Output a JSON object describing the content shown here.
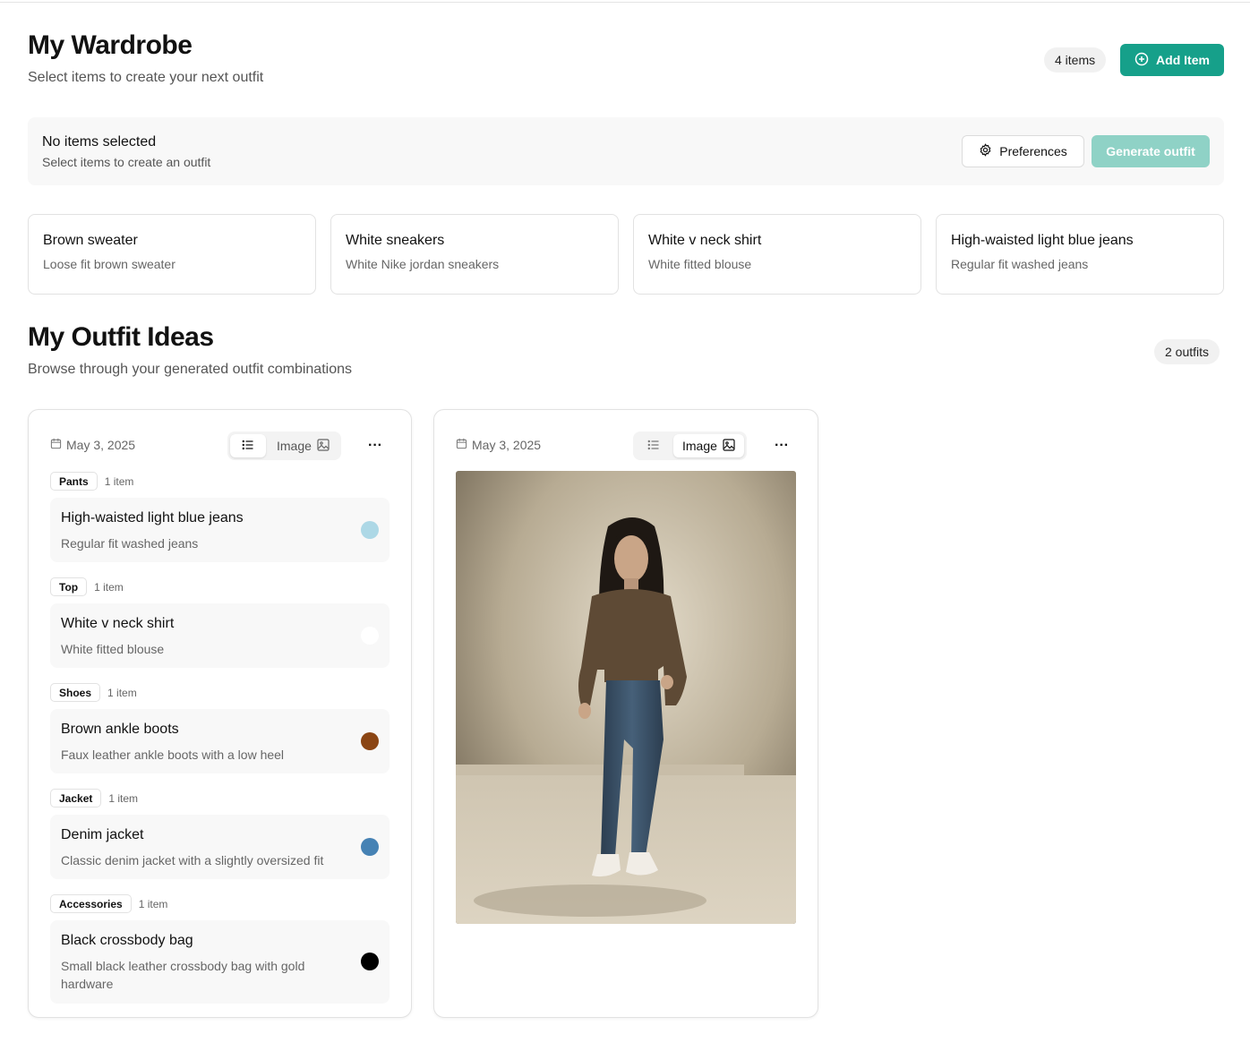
{
  "header": {
    "title": "My Wardrobe",
    "subtitle": "Select items to create your next outfit",
    "item_count": "4 items",
    "add_item_label": "Add Item"
  },
  "selection": {
    "title": "No items selected",
    "subtitle": "Select items to create an outfit",
    "preferences_label": "Preferences",
    "generate_label": "Generate outfit"
  },
  "wardrobe": {
    "items": [
      {
        "name": "Brown sweater",
        "description": "Loose fit brown sweater"
      },
      {
        "name": "White sneakers",
        "description": "White Nike jordan sneakers"
      },
      {
        "name": "White v neck shirt",
        "description": "White fitted blouse"
      },
      {
        "name": "High-waisted light blue jeans",
        "description": "Regular fit washed jeans"
      }
    ]
  },
  "outfits_section": {
    "title": "My Outfit Ideas",
    "subtitle": "Browse through your generated outfit combinations",
    "count": "2 outfits"
  },
  "outfits": [
    {
      "date": "May 3, 2025",
      "view_mode": "list",
      "image_label": "Image",
      "more_label": "···",
      "categories": [
        {
          "category": "Pants",
          "count": "1 item",
          "item": {
            "name": "High-waisted light blue jeans",
            "description": "Regular fit washed jeans",
            "color": "#add8e6"
          }
        },
        {
          "category": "Top",
          "count": "1 item",
          "item": {
            "name": "White v neck shirt",
            "description": "White fitted blouse",
            "color": "#ffffff"
          }
        },
        {
          "category": "Shoes",
          "count": "1 item",
          "item": {
            "name": "Brown ankle boots",
            "description": "Faux leather ankle boots with a low heel",
            "color": "#8b4513"
          }
        },
        {
          "category": "Jacket",
          "count": "1 item",
          "item": {
            "name": "Denim jacket",
            "description": "Classic denim jacket with a slightly oversized fit",
            "color": "#4682b4"
          }
        },
        {
          "category": "Accessories",
          "count": "1 item",
          "item": {
            "name": "Black crossbody bag",
            "description": "Small black leather crossbody bag with gold hardware",
            "color": "#000000"
          }
        }
      ]
    },
    {
      "date": "May 3, 2025",
      "view_mode": "image",
      "image_label": "Image",
      "more_label": "···"
    }
  ],
  "colors": {
    "accent": "#16a08a",
    "accent_disabled": "#8fd2c6"
  }
}
